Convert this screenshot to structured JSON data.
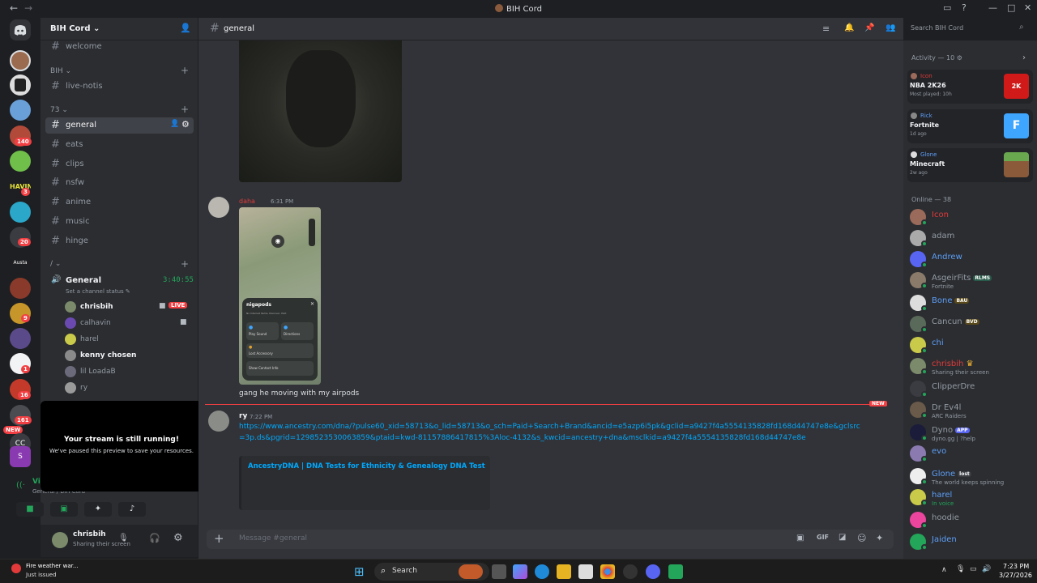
{
  "window": {
    "title": "BIH Cord"
  },
  "server": {
    "name": "BIH Cord"
  },
  "guild_badges": [
    "140",
    "3",
    "20",
    "9",
    "16",
    "1",
    "161",
    "NEW"
  ],
  "guild_labels": {
    "c": "CC",
    "s": "S"
  },
  "categories": {
    "bih": "BIH",
    "c73": "73",
    "slash": "/"
  },
  "channels": {
    "welcome": "welcome",
    "live_notis": "live-notis",
    "general": "general",
    "eats": "eats",
    "clips": "clips",
    "nsfw": "nsfw",
    "anime": "anime",
    "music": "music",
    "hinge": "hinge"
  },
  "voice": {
    "name": "General",
    "timer": "3:40:55",
    "status": "Set a channel status",
    "live": "LIVE",
    "users": [
      "chrisbih",
      "calhavin",
      "harel",
      "kenny chosen",
      "lil LoadaB",
      "ry"
    ]
  },
  "stream_popup": {
    "title": "Your stream is still running!",
    "body": "We've paused this preview to save your resources."
  },
  "voice_connected": {
    "label": "Vi",
    "sub": "General / BIH Cord"
  },
  "user": {
    "name": "chrisbih",
    "status": "Sharing their screen"
  },
  "channel_header": {
    "name": "general",
    "search_placeholder": "Search BIH Cord"
  },
  "messages": {
    "m1_author": "daha",
    "m1_time": "6:31 PM",
    "m1_text": "gang he moving with my airpods",
    "new_label": "NEW",
    "m2_author": "ry",
    "m2_time": "7:22 PM",
    "m2_link": "https://www.ancestry.com/dna/?pulse60_xid=58713&o_lid=58713&o_sch=Paid+Search+Brand&ancid=e5azp6i5pk&gclid=a9427f4a5554135828fd168d44747e8e&gclsrc=3p.ds&pgrid=1298523530063859&ptaid=kwd-81157886417815%3Aloc-4132&s_kwcid=ancestry+dna&msclkid=a9427f4a5554135828fd168d44747e8e",
    "embed_title": "AncestryDNA | DNA Tests for Ethnicity & Genealogy DNA Test"
  },
  "map_card": {
    "title": "nigapods",
    "sub": "No Internet Items, Discover, Halt",
    "cell1": "Play Sound",
    "cell2": "Directions",
    "lost": "Lost Accessory",
    "contact": "Show Contact Info"
  },
  "composer": {
    "placeholder": "Message #general"
  },
  "activity": {
    "label": "Activity — 10",
    "cards": [
      {
        "user": "Icon",
        "game": "NBA 2K26",
        "detail": "Most played: 10h",
        "color": "#e23a3a",
        "thumb": "2K"
      },
      {
        "user": "Rick",
        "game": "Fortnite",
        "detail": "1d ago",
        "color": "#3ea6ff",
        "thumb": "F"
      },
      {
        "user": "Glone",
        "game": "Minecraft",
        "detail": "2w ago",
        "color": "#6aa84f",
        "thumb": ""
      }
    ]
  },
  "online_label": "Online — 38",
  "members": [
    {
      "name": "Icon",
      "color": "#e23a3a",
      "sub": "",
      "tag": ""
    },
    {
      "name": "adam",
      "color": "#949ba4",
      "sub": "",
      "tag": ""
    },
    {
      "name": "Andrew",
      "color": "#5e9ef5",
      "sub": "",
      "tag": ""
    },
    {
      "name": "AsgeirFits",
      "color": "#949ba4",
      "sub": "Fortnite",
      "tag": "RLMS"
    },
    {
      "name": "Bone",
      "color": "#5e9ef5",
      "sub": "",
      "tag": "BAU"
    },
    {
      "name": "Cancun",
      "color": "#949ba4",
      "sub": "",
      "tag": "BVD"
    },
    {
      "name": "chi",
      "color": "#5e9ef5",
      "sub": "",
      "tag": ""
    },
    {
      "name": "chrisbih",
      "color": "#e23a3a",
      "sub": "Sharing their screen",
      "tag": ""
    },
    {
      "name": "ClipperDre",
      "color": "#949ba4",
      "sub": "",
      "tag": ""
    },
    {
      "name": "Dr Ev4l",
      "color": "#949ba4",
      "sub": "ARC Raiders",
      "tag": ""
    },
    {
      "name": "Dyno",
      "color": "#949ba4",
      "sub": "dyno.gg | ?help",
      "tag": "APP"
    },
    {
      "name": "evo",
      "color": "#5e9ef5",
      "sub": "",
      "tag": ""
    },
    {
      "name": "Glone",
      "color": "#5e9ef5",
      "sub": "The world keeps spinning",
      "tag": "lost"
    },
    {
      "name": "harel",
      "color": "#5e9ef5",
      "sub": "In voice",
      "tag": ""
    },
    {
      "name": "hoodie",
      "color": "#949ba4",
      "sub": "",
      "tag": ""
    },
    {
      "name": "Jaiden",
      "color": "#5e9ef5",
      "sub": "",
      "tag": ""
    }
  ],
  "taskbar": {
    "weather": "Fire weather war...",
    "weather_sub": "Just issued",
    "search": "Search",
    "time": "7:23 PM",
    "date": "3/27/2026"
  }
}
